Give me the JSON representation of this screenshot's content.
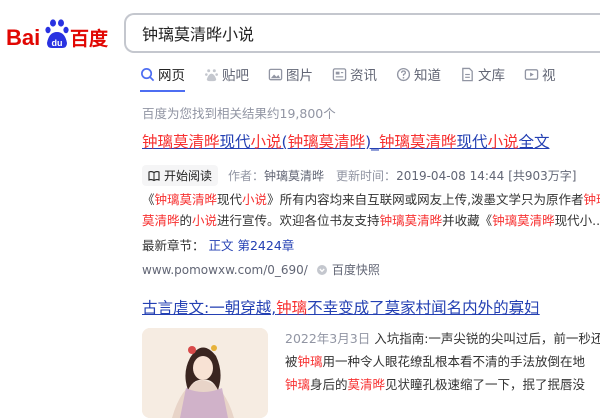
{
  "brand": {
    "bai": "Bai",
    "du": "du",
    "chinese": "百度",
    "brand_blue": "#2932e1",
    "brand_red": "#e10602"
  },
  "search": {
    "query": "钟璃莫清晔小说"
  },
  "tabs": [
    {
      "label": "网页",
      "icon": "search-icon",
      "active": true
    },
    {
      "label": "贴吧",
      "icon": "paw-icon"
    },
    {
      "label": "图片",
      "icon": "image-icon"
    },
    {
      "label": "资讯",
      "icon": "news-icon"
    },
    {
      "label": "知道",
      "icon": "question-icon"
    },
    {
      "label": "文库",
      "icon": "document-icon"
    },
    {
      "label": "视",
      "icon": "video-icon"
    }
  ],
  "result_count": "百度为您找到相关结果约19,800个",
  "result1": {
    "title_parts": [
      "钟璃莫清晔",
      "现代",
      "小说",
      "(",
      "钟璃莫清晔",
      ")_",
      "钟璃莫清晔",
      "现代",
      "小说",
      "全文"
    ],
    "read_button": "开始阅读",
    "author_label": "作者：",
    "author": "钟璃莫清晔",
    "update_label": "更新时间：",
    "update_time": "2019-04-08 14:44",
    "wordcount": "[共903万字]",
    "desc_parts": [
      "《",
      "钟璃莫清晔",
      "现代",
      "小说",
      "》所有内容均来自互联网或网友上传,泼墨文学只为原作者",
      "钟璃莫清晔",
      "的",
      "小说",
      "进行宣传。欢迎各位书友支持",
      "钟璃莫清晔",
      "并收藏《",
      "钟璃莫清晔",
      "现代小..."
    ],
    "latest_label": "最新章节：",
    "latest_chapter": "正文 第2424章",
    "url": "www.pomowxw.com/0_690/",
    "snapshot": "百度快照"
  },
  "result2": {
    "title_parts": [
      "古言虐文:一朝穿越,",
      "钟璃",
      "不幸变成了莫家村闻名内外的寡妇"
    ],
    "date": "2022年3月3日",
    "line1": "入坑指南:一声尖锐的尖叫过后，前一秒还",
    "line2_parts": [
      "被",
      "钟璃",
      "用一种令人眼花缭乱根本看不清的手法放倒在地"
    ],
    "line3_parts": [
      "钟璃",
      "身后的",
      "莫清晔",
      "见状瞳孔极速缩了一下，抿了抿唇没"
    ]
  }
}
